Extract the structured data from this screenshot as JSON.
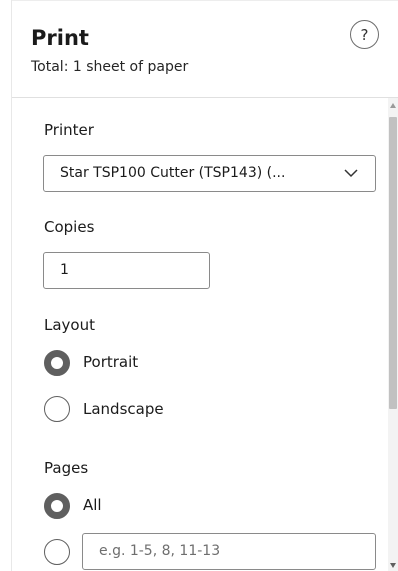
{
  "header": {
    "title": "Print",
    "subtitle": "Total: 1 sheet of paper",
    "help_label": "?"
  },
  "printer": {
    "label": "Printer",
    "selected": "Star TSP100 Cutter (TSP143) (..."
  },
  "copies": {
    "label": "Copies",
    "value": "1"
  },
  "layout": {
    "label": "Layout",
    "options": [
      {
        "label": "Portrait",
        "checked": true
      },
      {
        "label": "Landscape",
        "checked": false
      }
    ]
  },
  "pages": {
    "label": "Pages",
    "options": [
      {
        "label": "All",
        "checked": true
      },
      {
        "label": "",
        "checked": false
      }
    ],
    "range_placeholder": "e.g. 1-5, 8, 11-13"
  },
  "icons": {
    "select_arrow": "chevron-down-icon",
    "help": "question-mark-icon",
    "scroll_up": "scroll-up-arrow-icon",
    "scroll_down": "scroll-down-arrow-icon"
  }
}
